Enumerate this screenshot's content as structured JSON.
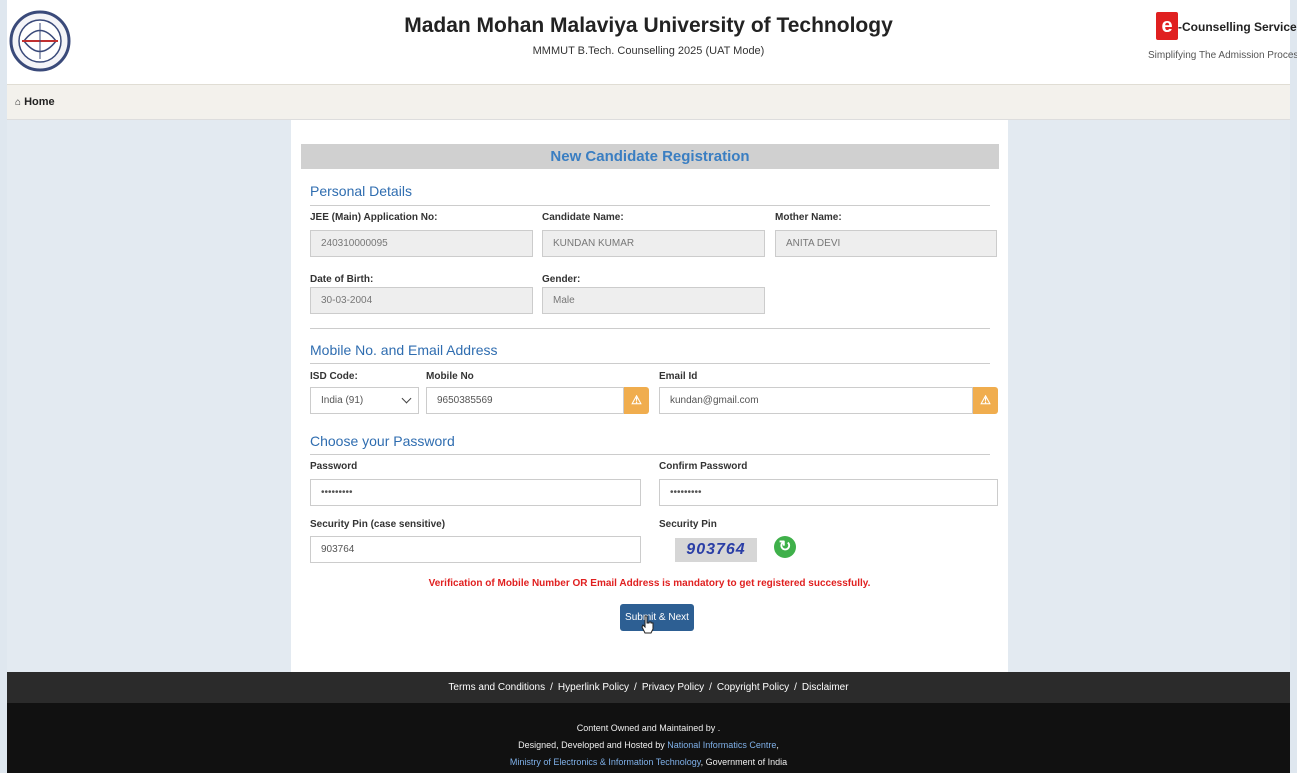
{
  "header": {
    "title": "Madan Mohan Malaviya University of Technology",
    "subtitle": "MMMUT B.Tech. Counselling 2025 (UAT Mode)",
    "ec_badge": "e",
    "ec_name": "-Counselling Services",
    "ec_tagline": "Simplifying The Admission Process"
  },
  "nav": {
    "home_label": "Home"
  },
  "form": {
    "banner": "New Candidate Registration",
    "personal": {
      "heading": "Personal Details",
      "jee_label": "JEE (Main) Application No:",
      "jee_value": "240310000095",
      "name_label": "Candidate Name:",
      "name_value": "KUNDAN KUMAR",
      "mother_label": "Mother Name:",
      "mother_value": "ANITA DEVI",
      "dob_label": "Date of Birth:",
      "dob_value": "30-03-2004",
      "gender_label": "Gender:",
      "gender_value": "Male"
    },
    "contact": {
      "heading": "Mobile No. and Email Address",
      "isd_label": "ISD Code:",
      "isd_value": "India (91)",
      "mobile_label": "Mobile No",
      "mobile_value": "9650385569",
      "email_label": "Email Id",
      "email_value": "kundan@gmail.com",
      "warn_glyph": "⚠"
    },
    "password": {
      "heading": "Choose your Password",
      "pwd_label": "Password",
      "pwd_value": "•••••••••",
      "confirm_label": "Confirm Password",
      "confirm_value": "•••••••••",
      "pin_input_label": "Security Pin (case sensitive)",
      "pin_input_value": "903764",
      "pin_label": "Security Pin",
      "captcha_text": "903764",
      "refresh_glyph": "↻"
    },
    "notice": "Verification of Mobile Number OR Email Address is mandatory to get registered successfully.",
    "submit_label": "Submit & Next"
  },
  "footer": {
    "links": [
      "Terms and Conditions",
      "Hyperlink Policy",
      "Privacy Policy",
      "Copyright Policy",
      "Disclaimer"
    ],
    "separator": "/",
    "owned": "Content Owned and Maintained by .",
    "designed_prefix": "Designed, Developed and Hosted by",
    "nic": "National Informatics Centre",
    "comma": ",",
    "meity": "Ministry of Electronics & Information Technology",
    "goi": ", Government of India"
  }
}
